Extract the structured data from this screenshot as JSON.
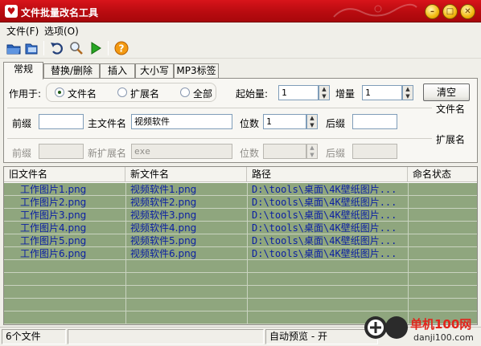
{
  "window": {
    "title": "文件批量改名工具",
    "minimize": "–",
    "maximize": "□",
    "close": "✕"
  },
  "menu": {
    "file": "文件(F)",
    "options": "选项(O)"
  },
  "toolbar": {
    "buttons": [
      "open-folder-icon",
      "open-file-icon",
      "undo-icon",
      "preview-search-icon",
      "run-icon",
      "help-icon"
    ]
  },
  "tabs": [
    "常规",
    "替换/删除",
    "插入",
    "大小写",
    "MP3标签"
  ],
  "general": {
    "apply_to_label": "作用于:",
    "radio_filename": "文件名",
    "radio_extension": "扩展名",
    "radio_all": "全部",
    "start_label": "起始量:",
    "start_value": "1",
    "step_label": "增量",
    "step_value": "1",
    "clear_button": "清空",
    "filename_section": "文件名",
    "prefix_label": "前缀",
    "prefix_value": "",
    "mainname_label": "主文件名",
    "mainname_value": "视频软件",
    "digits_label": "位数",
    "digits_value": "1",
    "suffix_label": "后缀",
    "suffix_value": "",
    "extension_section": "扩展名",
    "ext_prefix_label": "前缀",
    "ext_prefix_value": "",
    "new_ext_label": "新扩展名",
    "new_ext_value": "exe",
    "ext_digits_label": "位数",
    "ext_digits_value": "",
    "ext_suffix_label": "后缀",
    "ext_suffix_value": ""
  },
  "table": {
    "headers": [
      "旧文件名",
      "新文件名",
      "路径",
      "命名状态"
    ],
    "rows": [
      [
        "工作图片1.png",
        "视频软件1.png",
        "D:\\tools\\桌面\\4K壁纸图片...",
        ""
      ],
      [
        "工作图片2.png",
        "视频软件2.png",
        "D:\\tools\\桌面\\4K壁纸图片...",
        ""
      ],
      [
        "工作图片3.png",
        "视频软件3.png",
        "D:\\tools\\桌面\\4K壁纸图片...",
        ""
      ],
      [
        "工作图片4.png",
        "视频软件4.png",
        "D:\\tools\\桌面\\4K壁纸图片...",
        ""
      ],
      [
        "工作图片5.png",
        "视频软件5.png",
        "D:\\tools\\桌面\\4K壁纸图片...",
        ""
      ],
      [
        "工作图片6.png",
        "视频软件6.png",
        "D:\\tools\\桌面\\4K壁纸图片...",
        ""
      ]
    ]
  },
  "status": {
    "count": "6个文件",
    "preview": "自动预览 - 开"
  },
  "watermark": {
    "text": "单机100网",
    "url": "danji100.com"
  },
  "colors": {
    "titlebar": "#c10d12",
    "grid_rows": "#8fa67e",
    "grid_text": "#0b1fa3"
  }
}
